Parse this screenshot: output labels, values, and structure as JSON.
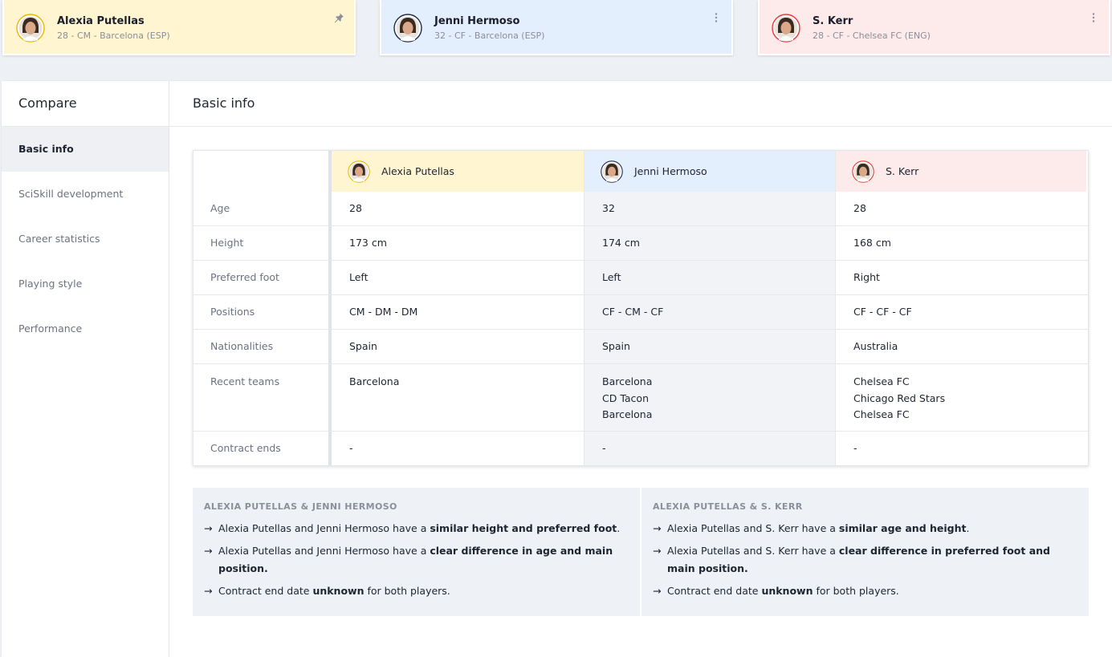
{
  "players": [
    {
      "name": "Alexia Putellas",
      "meta": "28 - CM - Barcelona (ESP)",
      "card_color": "#fff5d1",
      "ring_color": "#f0b400",
      "icon": "pin-icon"
    },
    {
      "name": "Jenni Hermoso",
      "meta": "32 - CF - Barcelona (ESP)",
      "card_color": "#e4effd",
      "ring_color": "#1e2a4a",
      "icon": "more-vertical-icon"
    },
    {
      "name": "S. Kerr",
      "meta": "28 - CF - Chelsea FC (ENG)",
      "card_color": "#fdeaea",
      "ring_color": "#e53935",
      "icon": "more-vertical-icon"
    }
  ],
  "sidebar": {
    "title": "Compare",
    "items": [
      {
        "label": "Basic info",
        "active": true
      },
      {
        "label": "SciSkill development"
      },
      {
        "label": "Career statistics"
      },
      {
        "label": "Playing style"
      },
      {
        "label": "Performance"
      }
    ]
  },
  "content": {
    "title": "Basic info"
  },
  "table": {
    "rows": [
      {
        "label": "Age",
        "values": [
          "28",
          "32",
          "28"
        ]
      },
      {
        "label": "Height",
        "values": [
          "173 cm",
          "174 cm",
          "168 cm"
        ]
      },
      {
        "label": "Preferred foot",
        "values": [
          "Left",
          "Left",
          "Right"
        ]
      },
      {
        "label": "Positions",
        "values": [
          "CM - DM - DM",
          "CF - CM - CF",
          "CF - CF - CF"
        ]
      },
      {
        "label": "Nationalities",
        "values": [
          "Spain",
          "Spain",
          "Australia"
        ]
      },
      {
        "label": "Recent teams",
        "values": [
          [
            "Barcelona"
          ],
          [
            "Barcelona",
            "CD Tacon",
            "Barcelona"
          ],
          [
            "Chelsea FC",
            "Chicago Red Stars",
            "Chelsea FC"
          ]
        ]
      },
      {
        "label": "Contract ends",
        "values": [
          "-",
          "-",
          "-"
        ]
      }
    ]
  },
  "insights": [
    {
      "heading": "ALEXIA PUTELLAS & JENNI HERMOSO",
      "lines": [
        {
          "pre": "Alexia Putellas and Jenni Hermoso have a ",
          "bold": "similar height and preferred foot",
          "post": "."
        },
        {
          "pre": "Alexia Putellas and Jenni Hermoso have a ",
          "bold": "clear difference in age and main position.",
          "post": ""
        },
        {
          "pre": "Contract end date ",
          "bold": "unknown",
          "post": " for both players."
        }
      ]
    },
    {
      "heading": "ALEXIA PUTELLAS & S. KERR",
      "lines": [
        {
          "pre": "Alexia Putellas and S. Kerr have a ",
          "bold": "similar age and height",
          "post": "."
        },
        {
          "pre": "Alexia Putellas and S. Kerr have a ",
          "bold": "clear difference in preferred foot and main position.",
          "post": ""
        },
        {
          "pre": "Contract end date ",
          "bold": "unknown",
          "post": " for both players."
        }
      ]
    }
  ],
  "arrow_glyph": "→"
}
